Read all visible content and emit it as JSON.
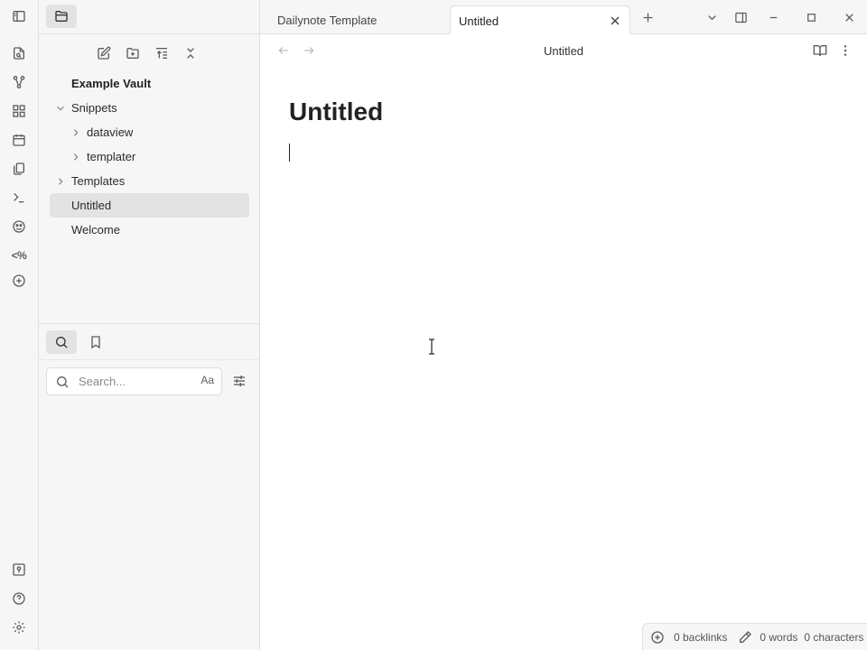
{
  "ribbon": {
    "top_icons": [
      "sidebar-toggle-icon",
      "quick-switcher-icon",
      "graph-icon",
      "canvas-icon",
      "calendar-icon",
      "templates-icon",
      "terminal-icon",
      "palette-icon"
    ],
    "templater_label": "<%",
    "bottom_icons": [
      "vault-switcher-icon",
      "help-icon",
      "settings-icon"
    ]
  },
  "sidebar": {
    "vault_name": "Example Vault",
    "tree": [
      {
        "label": "Snippets",
        "level": 0,
        "folder": true,
        "expanded": true
      },
      {
        "label": "dataview",
        "level": 1,
        "folder": true,
        "expanded": false
      },
      {
        "label": "templater",
        "level": 1,
        "folder": true,
        "expanded": false
      },
      {
        "label": "Templates",
        "level": 0,
        "folder": true,
        "expanded": false
      },
      {
        "label": "Untitled",
        "level": 0,
        "folder": false,
        "active": true
      },
      {
        "label": "Welcome",
        "level": 0,
        "folder": false
      }
    ],
    "search": {
      "placeholder": "Search...",
      "value": "",
      "case_label": "Aa"
    }
  },
  "tabs": [
    {
      "label": "Dailynote Template",
      "active": false
    },
    {
      "label": "Untitled",
      "active": true
    }
  ],
  "editor": {
    "view_title": "Untitled",
    "note_title": "Untitled"
  },
  "status": {
    "backlinks": "0 backlinks",
    "words": "0 words",
    "characters": "0 characters"
  },
  "colors": {
    "sidebar_bg": "#f6f6f6",
    "active_item_bg": "#e3e3e3",
    "border": "#e0e0e0",
    "icon": "#5c5c5c"
  }
}
